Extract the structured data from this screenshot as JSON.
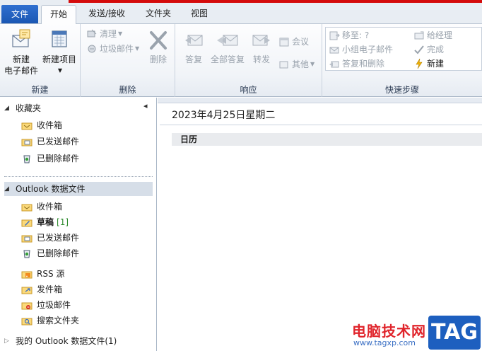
{
  "tabs": {
    "file": "文件",
    "home": "开始",
    "send_receive": "发送/接收",
    "folder": "文件夹",
    "view": "视图"
  },
  "ribbon": {
    "new_group": {
      "label": "新建",
      "new_email": "新建\n电子邮件",
      "new_email_l1": "新建",
      "new_email_l2": "电子邮件",
      "new_items": "新建项目"
    },
    "delete_group": {
      "label": "删除",
      "clean": "清理",
      "junk": "垃圾邮件",
      "delete": "删除"
    },
    "respond_group": {
      "label": "响应",
      "reply": "答复",
      "reply_all": "全部答复",
      "forward": "转发",
      "meeting": "会议",
      "more": "其他"
    },
    "quick_steps_group": {
      "label": "快速步骤",
      "move_to": "移至: ?",
      "team_email": "小组电子邮件",
      "reply_delete": "答复和删除",
      "to_manager": "给经理",
      "done": "完成",
      "create_new": "新建"
    }
  },
  "nav": {
    "favorites": {
      "label": "收藏夹",
      "items": [
        "收件箱",
        "已发送邮件",
        "已删除邮件"
      ]
    },
    "datafile": {
      "label": "Outlook 数据文件",
      "inbox": "收件箱",
      "drafts": "草稿",
      "drafts_count": "[1]",
      "sent": "已发送邮件",
      "deleted": "已删除邮件",
      "rss": "RSS 源",
      "outbox": "发件箱",
      "junk": "垃圾邮件",
      "search": "搜索文件夹"
    },
    "my_datafile": "我的 Outlook 数据文件(1)"
  },
  "main": {
    "date_title": "2023年4月25日星期二",
    "calendar_header": "日历"
  },
  "watermark": {
    "site_name": "电脑技术网",
    "url": "www.tagxp.com",
    "tag": "TAG"
  },
  "colors": {
    "file_tab": "#1b57b3",
    "accent_red": "#d40b0b",
    "selected_row": "#d6dee8"
  }
}
